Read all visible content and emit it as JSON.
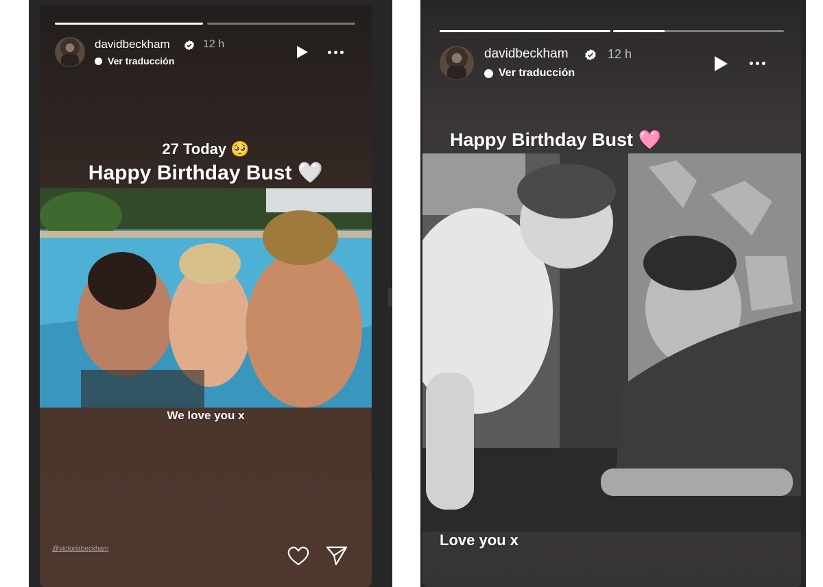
{
  "stories": [
    {
      "username": "davidbeckham",
      "time_ago": "12 h",
      "translate_label": "Ver traducción",
      "progress": [
        1.0,
        0.0
      ],
      "caption_top": "27 Today 🥺",
      "caption_main": "Happy Birthday Bust 🤍",
      "caption_bottom": "We love you x",
      "mention": "@victoriabeckham",
      "icons": [
        "verified-badge-icon",
        "translate-dot-icon",
        "play-icon",
        "more-options-icon",
        "heart-icon",
        "send-icon"
      ]
    },
    {
      "username": "davidbeckham",
      "time_ago": "12 h",
      "translate_label": "Ver traducción",
      "progress": [
        1.0,
        0.3
      ],
      "caption_main": "Happy Birthday Bust 🩷",
      "caption_bottom": "Love you x",
      "icons": [
        "verified-badge-icon",
        "translate-dot-icon",
        "play-icon",
        "more-options-icon"
      ]
    }
  ],
  "colors": {
    "progress_track": "#9a9a9a",
    "progress_fill": "#ffffff",
    "verified": "#ffffff",
    "left_background": "#4a352c",
    "right_background": "#3e3b3a"
  }
}
